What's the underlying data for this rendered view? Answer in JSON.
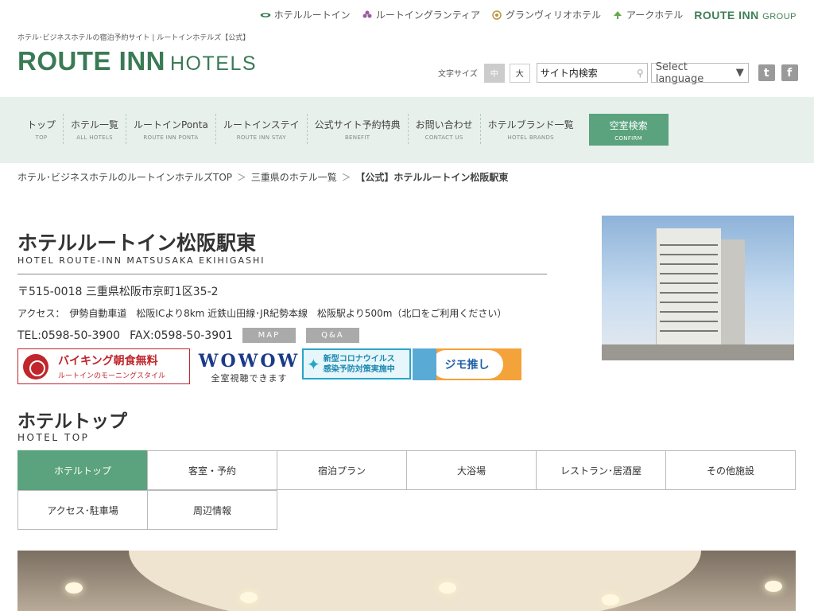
{
  "brands": [
    {
      "name": "ホテルルートイン",
      "icon": "route-inn-leaf-icon"
    },
    {
      "name": "ルートイングランティア",
      "icon": "grantia-flower-icon"
    },
    {
      "name": "グランヴィリオホテル",
      "icon": "grandvrio-emblem-icon"
    },
    {
      "name": "アークホテル",
      "icon": "ark-tree-icon"
    }
  ],
  "group_logo": {
    "main": "ROUTE INN",
    "sub": "GROUP"
  },
  "tagline": "ホテル･ビジネスホテルの宿泊予約サイト | ルートインホテルズ【公式】",
  "logo": {
    "main": "ROUTE INN",
    "sub": "HOTELS"
  },
  "tools": {
    "font_size_label": "文字サイズ",
    "font_sizes": [
      "中",
      "大"
    ],
    "search_value": "サイト内検索",
    "language_label": "Select language"
  },
  "nav": [
    {
      "jp": "トップ",
      "en": "TOP"
    },
    {
      "jp": "ホテル一覧",
      "en": "ALL HOTELS"
    },
    {
      "jp": "ルートインPonta",
      "en": "ROUTE INN PONTA"
    },
    {
      "jp": "ルートインステイ",
      "en": "ROUTE INN STAY"
    },
    {
      "jp": "公式サイト予約特典",
      "en": "BENEFIT"
    },
    {
      "jp": "お問い合わせ",
      "en": "CONTACT US"
    },
    {
      "jp": "ホテルブランド一覧",
      "en": "HOTEL BRANDS"
    },
    {
      "jp": "空室検索",
      "en": "CONFIRM"
    }
  ],
  "breadcrumb": [
    "ホテル･ビジネスホテルのルートインホテルズTOP",
    "三重県のホテル一覧",
    "【公式】ホテルルートイン松阪駅東"
  ],
  "hotel": {
    "name": "ホテルルートイン松阪駅東",
    "name_en": "HOTEL ROUTE-INN MATSUSAKA EKIHIGASHI",
    "address": "〒515-0018 三重県松阪市京町1区35-2",
    "access": "アクセス：　伊勢自動車道　松阪ICより8km 近鉄山田線･JR紀勢本線　松阪駅より500m（北口をご利用ください）",
    "tel": "TEL:0598-50-3900",
    "fax": "FAX:0598-50-3901",
    "map_label": "MAP",
    "qa_label": "Q&A"
  },
  "banners": {
    "viking_title": "バイキング朝食無料",
    "viking_sub": "ルートインのモーニングスタイル",
    "wowow_title": "WOWOW",
    "wowow_sub": "全室視聴できます",
    "corona_line1": "新型コロナウイルス",
    "corona_line2": "感染予防対策実施中",
    "jimo_title": "ジモ推し"
  },
  "section": {
    "title": "ホテルトップ",
    "title_en": "HOTEL TOP"
  },
  "tabs": [
    "ホテルトップ",
    "客室・予約",
    "宿泊プラン",
    "大浴場",
    "レストラン･居酒屋",
    "その他施設",
    "アクセス･駐車場",
    "周辺情報"
  ],
  "colors": {
    "brand_green": "#3a7a55",
    "accent_green": "#5aa37e",
    "nav_bg": "#e8f0ec"
  }
}
